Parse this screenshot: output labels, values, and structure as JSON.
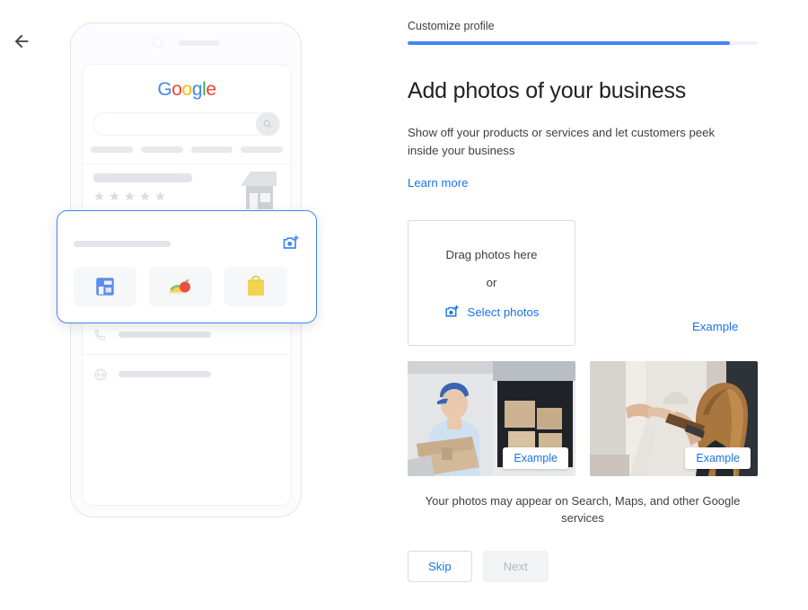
{
  "nav": {
    "back_icon": "arrow-left-icon"
  },
  "phone_preview": {
    "logo": {
      "name": "google-logo",
      "letters": [
        "G",
        "o",
        "o",
        "g",
        "l",
        "e"
      ]
    },
    "search_icon": "magnifier-icon",
    "storefront_icon": "storefront-icon",
    "rating_stars": 5,
    "info_rows": [
      {
        "icon": "location-pin-icon",
        "has_map_thumbnail": true
      },
      {
        "icon": "clock-icon",
        "has_map_thumbnail": false
      },
      {
        "icon": "phone-icon",
        "has_map_thumbnail": false
      },
      {
        "icon": "globe-icon",
        "has_map_thumbnail": false
      }
    ],
    "highlight_card": {
      "add_photo_icon": "add-photo-camera-icon",
      "thumbnails": [
        {
          "icon": "blue-storefront-icon"
        },
        {
          "icon": "food-taco-apple-icon"
        },
        {
          "icon": "yellow-shopping-bag-icon"
        }
      ]
    }
  },
  "panel": {
    "step_label": "Customize profile",
    "progress_percent": 92,
    "headline": "Add photos of your business",
    "subtext": "Show off your products or services and let customers peek inside your business",
    "learn_more_label": "Learn more",
    "dropzone": {
      "title": "Drag photos here",
      "or_label": "or",
      "select_label": "Select photos",
      "select_icon": "add-photo-camera-icon"
    },
    "example_link_label": "Example",
    "example_photos": [
      {
        "alt": "delivery-person-with-boxes",
        "badge": "Example"
      },
      {
        "alt": "hairdresser-styling-client",
        "badge": "Example"
      }
    ],
    "footnote": "Your photos may appear on Search, Maps, and other Google services",
    "buttons": {
      "skip": "Skip",
      "next": "Next"
    }
  },
  "colors": {
    "accent_blue": "#1a73e8",
    "progress_blue": "#4285F4",
    "disabled_gray": "#f1f3f4",
    "border_gray": "#dadce0"
  }
}
